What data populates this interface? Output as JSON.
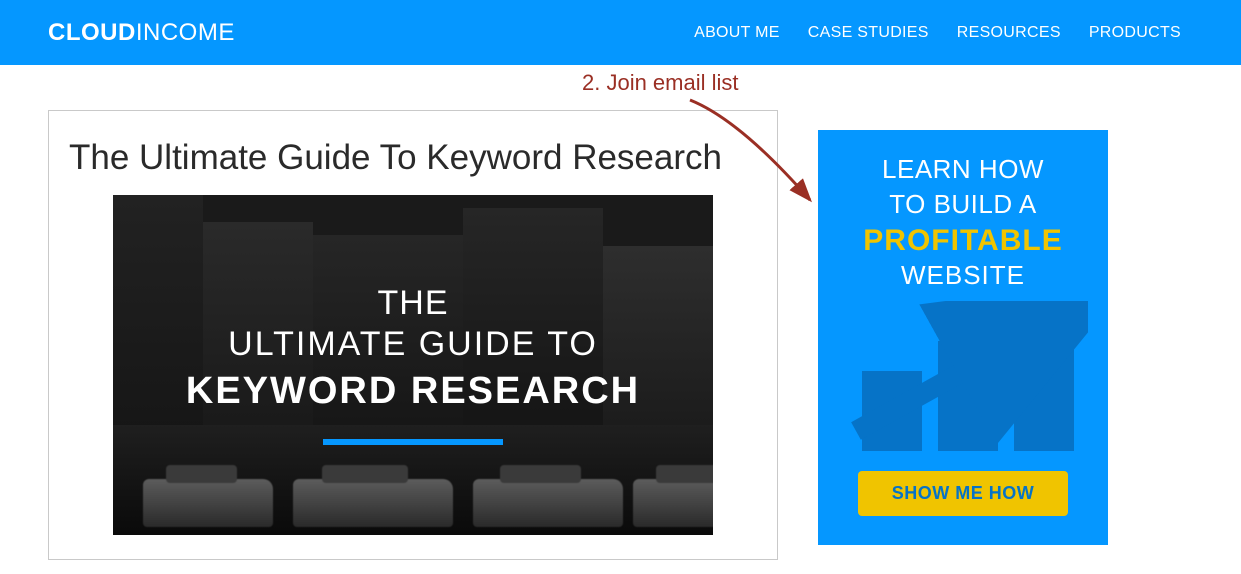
{
  "header": {
    "logo_bold": "CLOUD",
    "logo_light": "INCOME",
    "nav": [
      "ABOUT ME",
      "CASE STUDIES",
      "RESOURCES",
      "PRODUCTS"
    ]
  },
  "annotation": {
    "label": "2. Join email list"
  },
  "article": {
    "title": "The Ultimate Guide To Keyword Research",
    "hero_line1": "THE",
    "hero_line2": "ULTIMATE GUIDE TO",
    "hero_line3": "KEYWORD RESEARCH"
  },
  "sidebar": {
    "promo_line1": "LEARN HOW",
    "promo_line2": "TO BUILD A",
    "promo_highlight": "PROFITABLE",
    "promo_line3": "WEBSITE",
    "promo_cta": "SHOW ME HOW"
  }
}
